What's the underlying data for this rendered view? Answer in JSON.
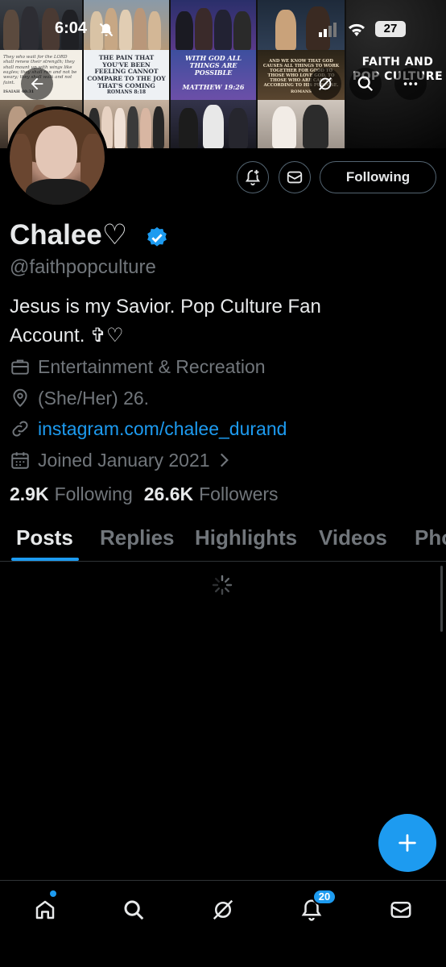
{
  "status_bar": {
    "time": "6:04",
    "battery": "27"
  },
  "banner": {
    "tiles": {
      "quote_left": "They who wait for the LORD shall renew their strength; they shall mount up with wings like eagles; they shall run and not be weary; they shall walk and not faint.",
      "quote_left_ref": "ISAIAH 40:31",
      "pain_text": "THE PAIN THAT YOU'VE BEEN FEELING CANNOT COMPARE TO THE JOY THAT'S COMING",
      "pain_ref": "ROMANS 8:18",
      "god_text": "WITH GOD ALL THINGS ARE POSSIBLE",
      "god_ref": "MATTHEW 19:26",
      "know_text": "AND WE KNOW THAT GOD CAUSES ALL THINGS TO WORK TOGETHER FOR GOOD TO THOSE WHO LOVE GOD, TO THOSE WHO ARE CALLED ACCORDING TO HIS PURPOSE.",
      "know_ref": "ROMANS",
      "faith_title": "FAITH AND POP CULTURE"
    }
  },
  "profile": {
    "name": "Chalee♡",
    "handle": "@faithpopculture",
    "bio": "Jesus is my Savior. Pop Culture Fan Account. ✞♡",
    "category": "Entertainment & Recreation",
    "location": "(She/Her) 26.",
    "website": "instagram.com/chalee_durand",
    "joined": "Joined January 2021",
    "following_count": "2.9K",
    "following_label": "Following",
    "followers_count": "26.6K",
    "followers_label": "Followers",
    "following_button": "Following"
  },
  "tabs": [
    "Posts",
    "Replies",
    "Highlights",
    "Videos",
    "Photos"
  ],
  "notifications_badge": "20",
  "colors": {
    "accent": "#1d9bf0",
    "background": "#000000",
    "muted": "#71767b",
    "text": "#e7e9ea"
  }
}
